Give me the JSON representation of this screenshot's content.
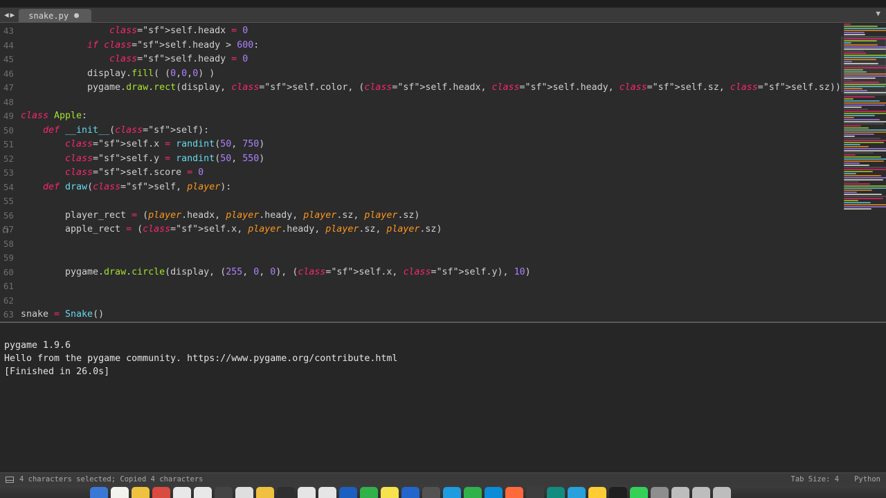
{
  "tab": {
    "filename": "snake.py"
  },
  "nav": {
    "back": "◀",
    "forward": "▶"
  },
  "lines_start": 43,
  "lines_end": 63,
  "bracket_line": 57,
  "code": {
    "l43": "                self.headx = 0",
    "l44": "            if self.heady > 600:",
    "l45": "                self.heady = 0",
    "l46": "            display.fill( (0,0,0) )",
    "l47": "            pygame.draw.rect(display, self.color, (self.headx, self.heady, self.sz, self.sz))",
    "l48": "",
    "l49": "class Apple:",
    "l50": "    def __init__(self):",
    "l51": "        self.x = randint(50, 750)",
    "l52": "        self.y = randint(50, 550)",
    "l53": "        self.score = 0",
    "l54": "    def draw(self, player):",
    "l55": "",
    "l56": "        player_rect = (player.headx, player.heady, player.sz, player.sz)",
    "l57": "        apple_rect = (self.x, player.heady, player.sz, player.sz)",
    "l58": "",
    "l59": "",
    "l60": "        pygame.draw.circle(display, (255, 0, 0), (self.x, self.y), 10)",
    "l61": "",
    "l62": "",
    "l63": "snake = Snake()"
  },
  "console": {
    "line1": "pygame 1.9.6",
    "line2": "Hello from the pygame community. https://www.pygame.org/contribute.html",
    "line3": "[Finished in 26.0s]"
  },
  "statusbar": {
    "left": "4 characters selected; Copied 4 characters",
    "tab_size": "Tab Size: 4",
    "language": "Python"
  },
  "colors": {
    "bg": "#2b2b2b",
    "keyword": "#f92672",
    "self": "#fd971f",
    "function": "#66d9ef",
    "call": "#a6e22e",
    "number": "#ae81ff"
  },
  "dock_apps": [
    "#3a78d6",
    "#f2f2ee",
    "#eec23e",
    "#d94b3f",
    "#e8e8e8",
    "#e8e8e8",
    "#444444",
    "#dedede",
    "#f0c040",
    "#2f2f2f",
    "#e5e5e5",
    "#e5e5e5",
    "#1b5fbf",
    "#30b14a",
    "#f5e24c",
    "#2266cc",
    "#525252",
    "#1f9bdf",
    "#30b14a",
    "#0a8dd6",
    "#ff6a3c",
    "#3d3d3d",
    "#128c7e",
    "#27a0dc",
    "#ffcc33",
    "#1f1f1f",
    "#34d058",
    "#8e8e8e",
    "#bdbdbd",
    "#bdbdbd",
    "#bdbdbd"
  ]
}
